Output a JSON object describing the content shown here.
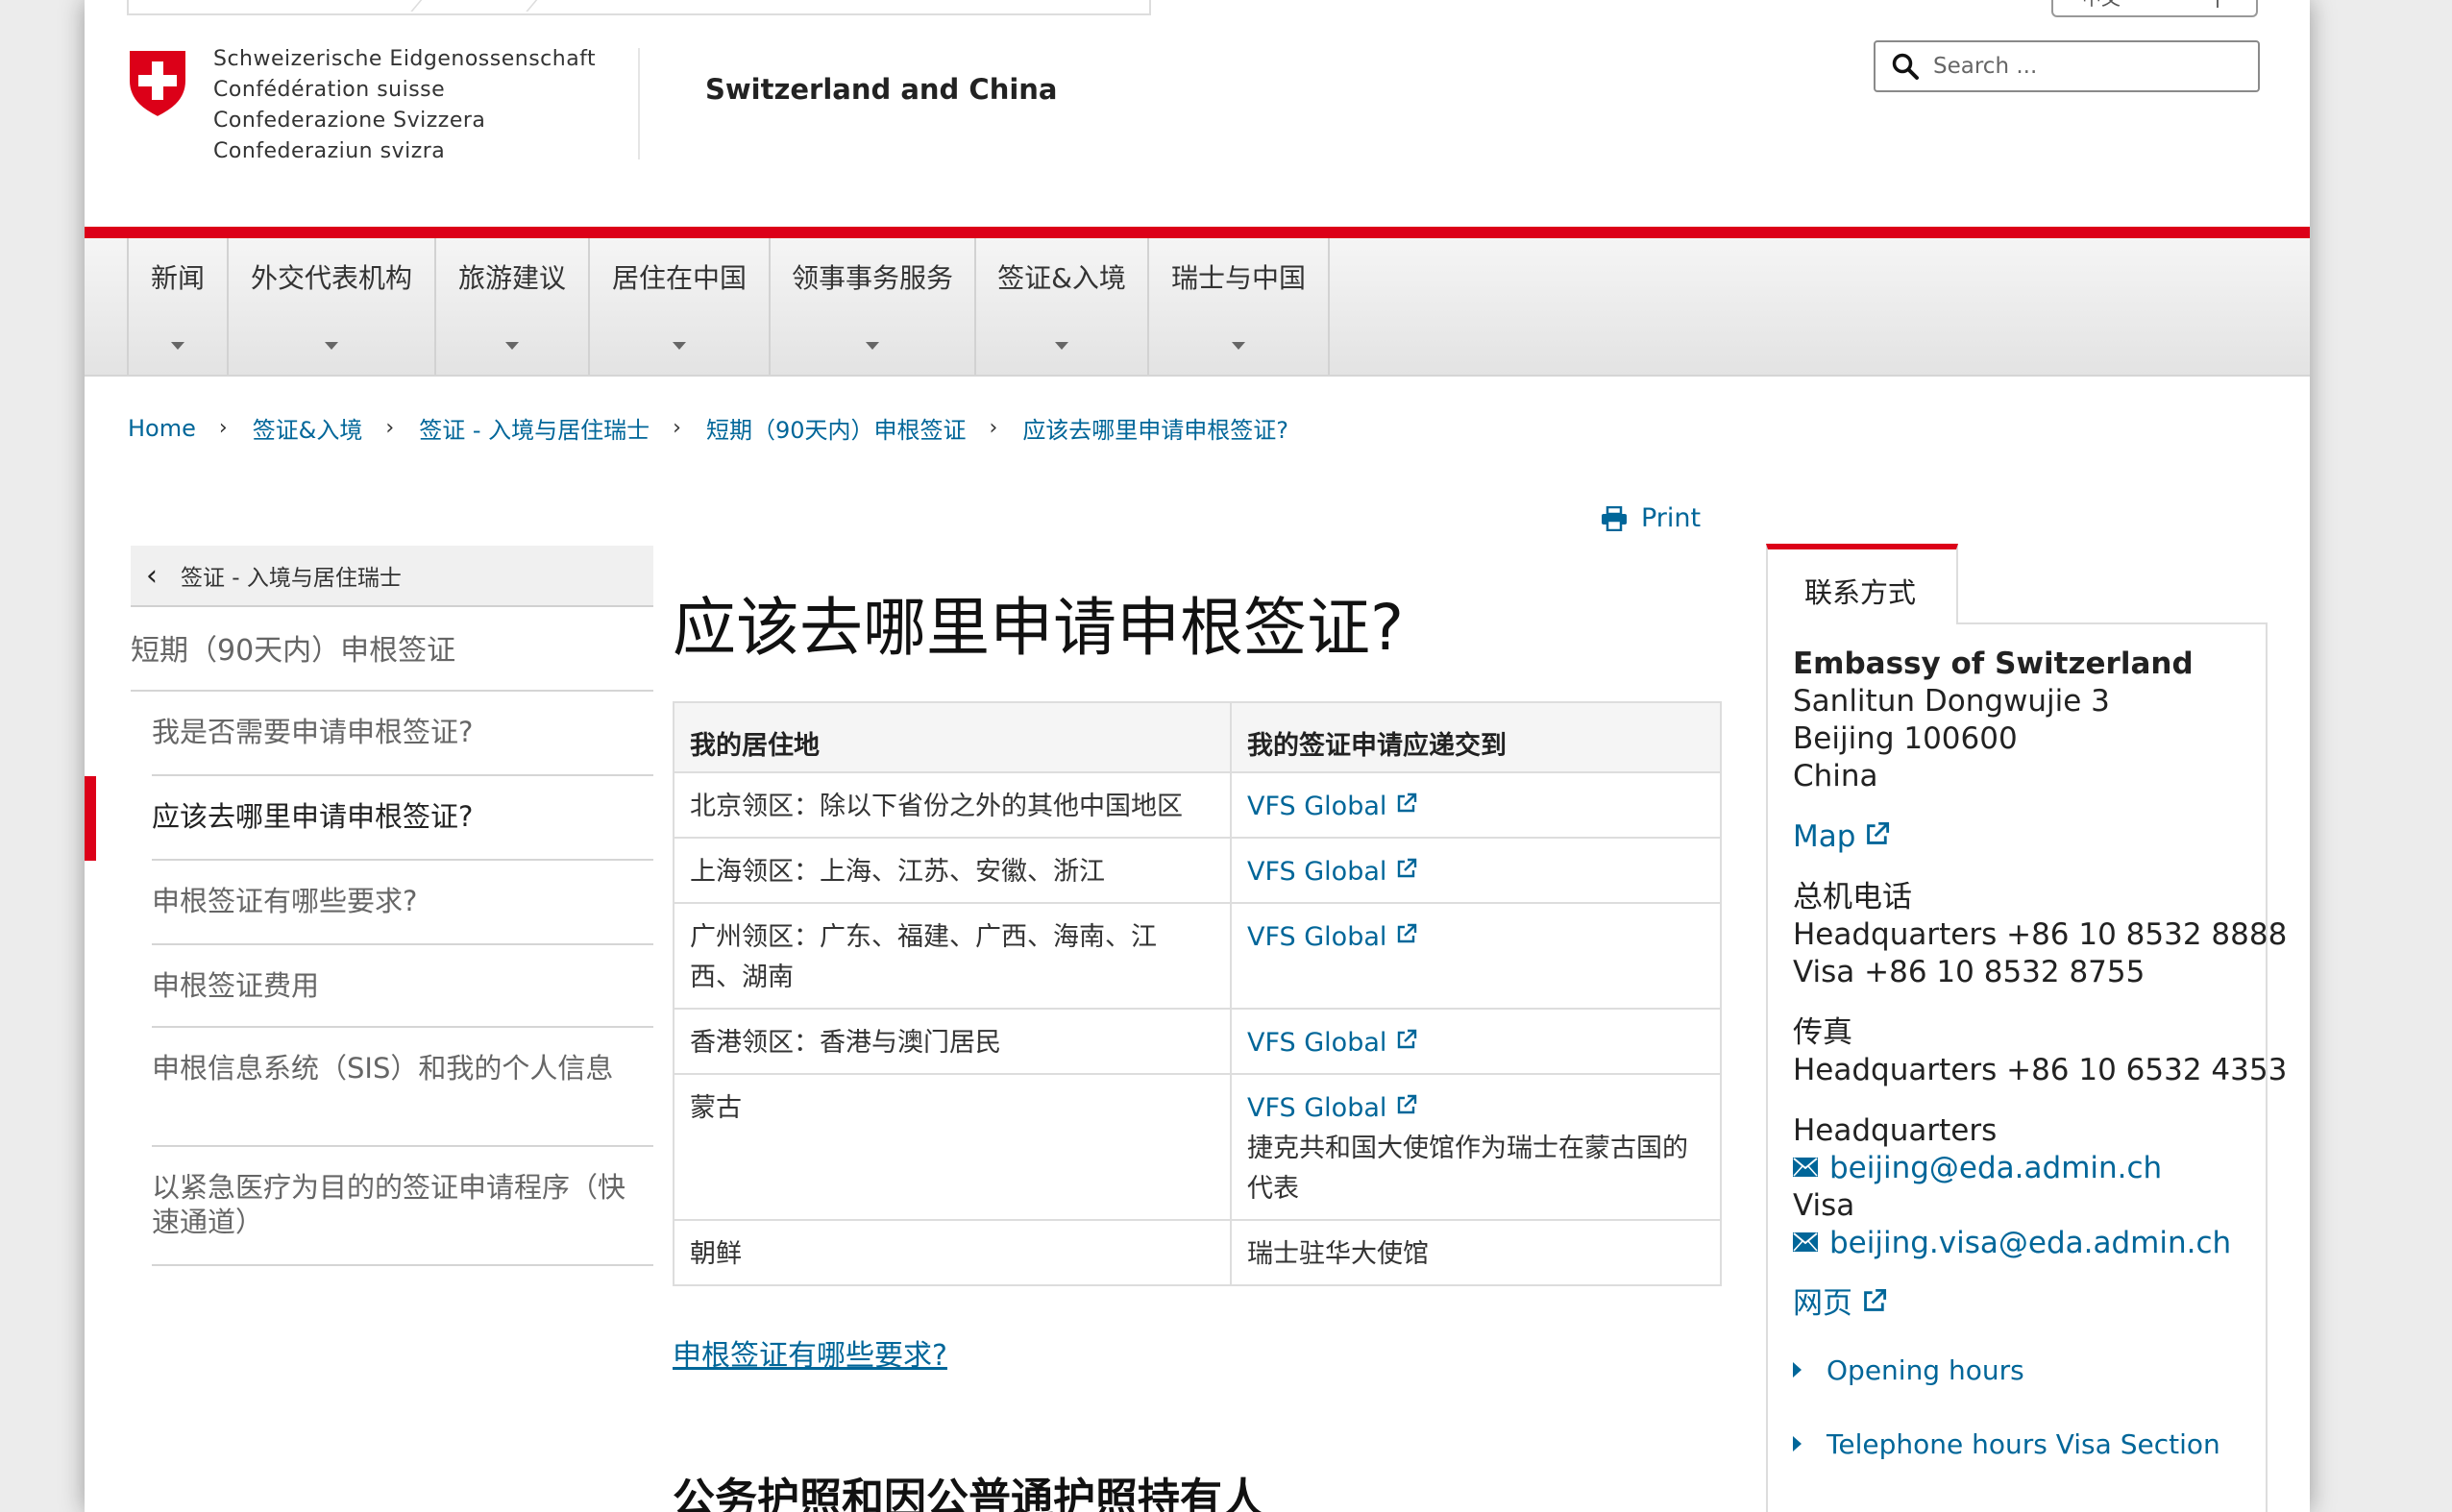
{
  "header": {
    "confederation": [
      "Schweizerische Eidgenossenschaft",
      "Confédération suisse",
      "Confederazione Svizzera",
      "Confederaziun svizra"
    ],
    "site_title": "Switzerland and China",
    "language": "中文",
    "search_placeholder": "Search ..."
  },
  "nav": {
    "items": [
      "新闻",
      "外交代表机构",
      "旅游建议",
      "居住在中国",
      "领事事务服务",
      "签证&入境",
      "瑞士与中国"
    ]
  },
  "breadcrumb": [
    "Home",
    "签证&入境",
    "签证 - 入境与居住瑞士",
    "短期（90天内）申根签证",
    "应该去哪里申请申根签证?"
  ],
  "left_nav": {
    "back_label": "签证 - 入境与居住瑞士",
    "parent": "短期（90天内）申根签证",
    "items": [
      "我是否需要申请申根签证?",
      "应该去哪里申请申根签证?",
      "申根签证有哪些要求?",
      "申根签证费用",
      "申根信息系统（SIS）和我的个人信息",
      "以紧急医疗为目的的签证申请程序（快速通道）"
    ],
    "active_index": 1
  },
  "main": {
    "print_label": "Print",
    "title": "应该去哪里申请申根签证?",
    "table": {
      "headers": [
        "我的居住地",
        "我的签证申请应递交到"
      ],
      "rows": [
        {
          "residence": "北京领区：除以下省份之外的其他中国地区",
          "link": "VFS Global",
          "note": ""
        },
        {
          "residence": "上海领区：上海、江苏、安徽、浙江",
          "link": "VFS Global",
          "note": ""
        },
        {
          "residence": "广州领区：广东、福建、广西、海南、江西、湖南",
          "link": "VFS Global",
          "note": ""
        },
        {
          "residence": "香港领区：香港与澳门居民",
          "link": "VFS Global",
          "note": ""
        },
        {
          "residence": "蒙古",
          "link": "VFS Global",
          "note": "捷克共和国大使馆作为瑞士在蒙古国的代表"
        },
        {
          "residence": "朝鲜",
          "link": "",
          "note": "瑞士驻华大使馆"
        }
      ]
    },
    "requirements_link": "申根签证有哪些要求?",
    "subheading": "公务护照和因公普通护照持有人"
  },
  "sidebar": {
    "tab_label": "联系方式",
    "org_name": "Embassy of Switzerland",
    "address": [
      "Sanlitun Dongwujie 3",
      "Beijing 100600",
      "China"
    ],
    "map_label": "Map",
    "phone_label": "总机电话",
    "phones": [
      "Headquarters +86 10 8532 8888",
      "Visa +86 10 8532 8755"
    ],
    "fax_label": "传真",
    "fax": "Headquarters +86 10 6532 4353",
    "hq_label": "Headquarters",
    "hq_email": "beijing@eda.admin.ch",
    "visa_label": "Visa",
    "visa_email": "beijing.visa@eda.admin.ch",
    "web_label": "网页",
    "opening_hours": "Opening hours",
    "telephone_hours": "Telephone hours Visa Section"
  },
  "colors": {
    "accent_red": "#dc0018",
    "link_blue": "#006699"
  }
}
